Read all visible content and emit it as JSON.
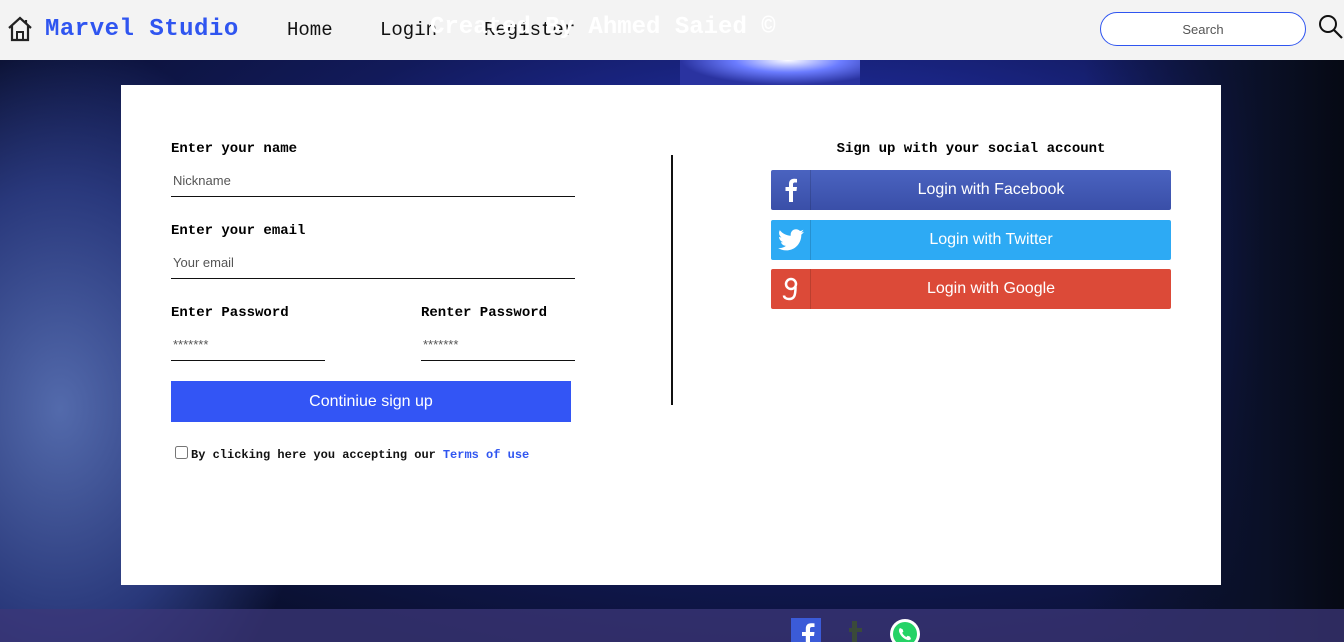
{
  "navbar": {
    "brand": "Marvel Studio",
    "links": [
      "Home",
      "Login",
      "Register"
    ],
    "search_placeholder": "Search"
  },
  "form": {
    "name_label": "Enter your name",
    "name_placeholder": "Nickname",
    "email_label": "Enter your email",
    "email_placeholder": "Your email",
    "password_label": "Enter Password",
    "password_placeholder": "*******",
    "repassword_label": "Renter Password",
    "repassword_placeholder": "*******",
    "submit_label": "Continiue sign up",
    "terms_text": "By clicking here you accepting our",
    "terms_link": "Terms of use"
  },
  "social": {
    "title": "Sign up with your social account",
    "facebook": "Login with Facebook",
    "twitter": "Login with Twitter",
    "google": "Login with Google",
    "colors": {
      "facebook": "#3f58b4",
      "twitter": "#2daaf4",
      "google": "#dc4a38"
    }
  },
  "footer": {
    "text": "Created By Ahmed Saied ©",
    "icons": [
      "facebook-icon",
      "tumblr-icon",
      "whatsapp-icon"
    ]
  },
  "colors": {
    "accent": "#2f55f0",
    "button": "#3355f5"
  }
}
